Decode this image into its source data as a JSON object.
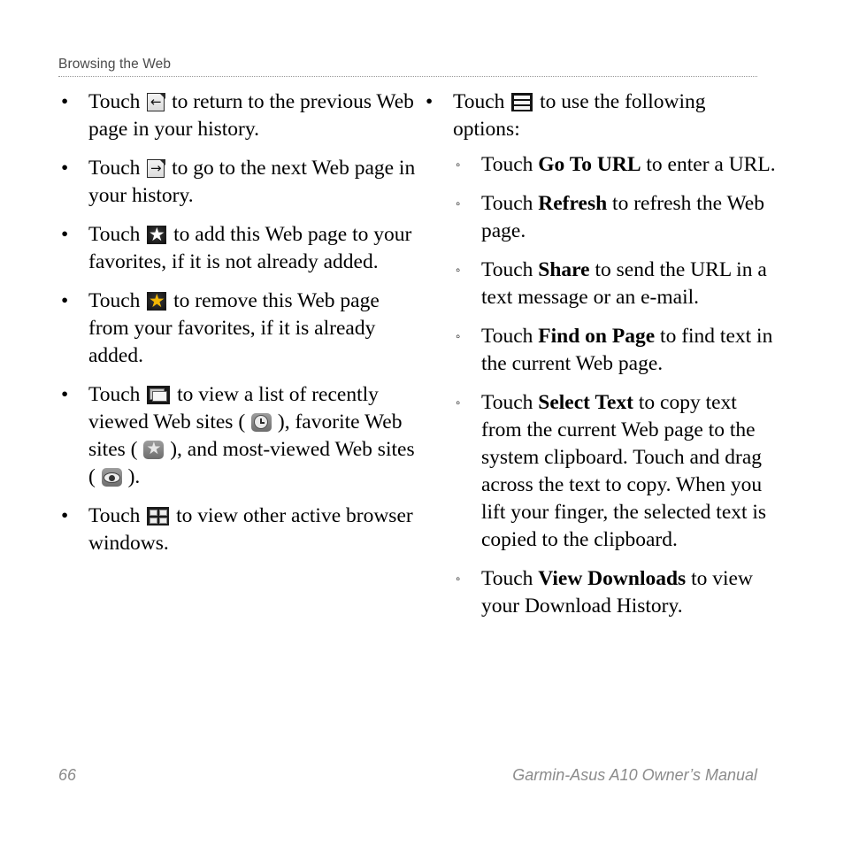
{
  "header": {
    "title": "Browsing the Web"
  },
  "left_column": {
    "bullets": [
      {
        "marker": "•",
        "icon": "back-arrow-page-icon",
        "pre": "Touch",
        "post": "to return to the previous Web page in your history."
      },
      {
        "marker": "•",
        "icon": "forward-arrow-page-icon",
        "pre": "Touch",
        "post": "to go to the next Web page in your history."
      },
      {
        "marker": "•",
        "icon": "white-star-icon",
        "pre": "Touch",
        "post": "to add this Web page to your favorites, if it is not already added."
      },
      {
        "marker": "•",
        "icon": "gold-star-icon",
        "pre": "Touch",
        "post": "to remove this Web page from your favorites, if it is already added."
      },
      {
        "marker": "•",
        "icon": "stacked-windows-icon",
        "pre": "Touch",
        "seg1": "to view a list of recently viewed Web sites (",
        "chip1": "clock-icon",
        "seg2": "), favorite Web sites (",
        "chip2": "small-star-icon",
        "seg3": "), and most-viewed Web sites (",
        "chip3": "eye-icon",
        "seg4": ")."
      },
      {
        "marker": "•",
        "icon": "window-grid-icon",
        "pre": "Touch",
        "post": "to view other active browser windows."
      }
    ]
  },
  "right_column": {
    "bullet": {
      "marker": "•",
      "icon": "hamburger-menu-icon",
      "pre": "Touch",
      "post": "to use the following options:"
    },
    "sub_bullets": [
      {
        "marker": "◦",
        "pre": "Touch",
        "bold": "Go To URL",
        "post": "to enter a URL."
      },
      {
        "marker": "◦",
        "pre": "Touch",
        "bold": "Refresh",
        "post": "to refresh the Web page."
      },
      {
        "marker": "◦",
        "pre": "Touch",
        "bold": "Share",
        "post": "to send the URL in a text message or an e-mail."
      },
      {
        "marker": "◦",
        "pre": "Touch",
        "bold": "Find on Page",
        "post": "to find text in the current Web page."
      },
      {
        "marker": "◦",
        "pre": "Touch",
        "bold": "Select Text",
        "post": "to copy text from the current Web page to the system clipboard. Touch and drag across the text to copy. When you lift your finger, the selected text is copied to the clipboard."
      },
      {
        "marker": "◦",
        "pre": "Touch",
        "bold": "View Downloads",
        "post": "to view your Download History."
      }
    ]
  },
  "footer": {
    "page_number": "66",
    "manual_title": "Garmin-Asus A10 Owner’s Manual"
  },
  "icon_glyphs": {
    "back_arrow": "←",
    "forward_arrow": "→",
    "star": "★"
  },
  "colors": {
    "page_background": "#ffffff",
    "body_text": "#000000",
    "header_text": "#4a4a4a",
    "header_rule": "#9a9a9a",
    "footer_text": "#8b8b8b",
    "gold_star": "#f2b705",
    "icon_dark": "#1b1b1b"
  }
}
